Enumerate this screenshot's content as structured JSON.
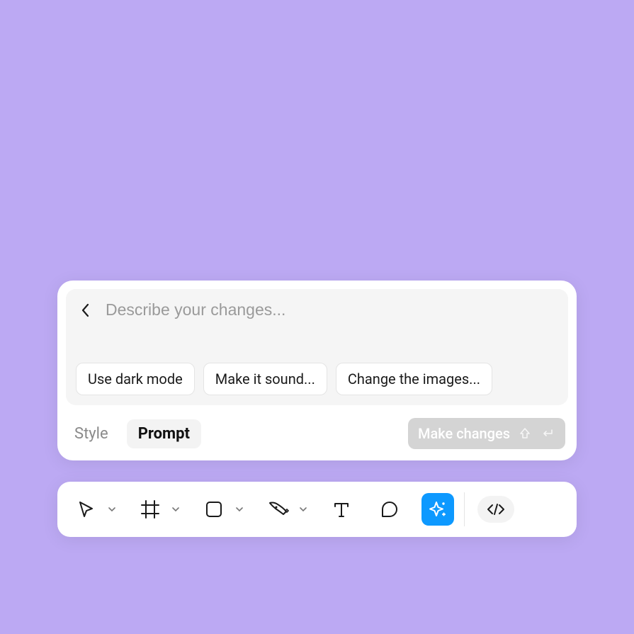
{
  "colors": {
    "background": "#bca9f3",
    "accent": "#0d99ff",
    "muted": "#d4d4d4"
  },
  "prompt_panel": {
    "placeholder": "Describe your changes...",
    "value": "",
    "suggestions": [
      {
        "label": "Use dark mode"
      },
      {
        "label": "Make it sound..."
      },
      {
        "label": "Change the images..."
      }
    ],
    "tabs": {
      "style": "Style",
      "prompt": "Prompt",
      "active": "prompt"
    },
    "submit": {
      "label": "Make changes",
      "shortcut": "Shift+Enter"
    },
    "icons": {
      "back": "chevron-left",
      "shift": "shift-key",
      "enter": "return-key"
    }
  },
  "toolbar": {
    "tools": [
      {
        "id": "select",
        "icon": "cursor-icon",
        "has_dropdown": true,
        "active": false
      },
      {
        "id": "frame",
        "icon": "frame-icon",
        "has_dropdown": true,
        "active": false
      },
      {
        "id": "rectangle",
        "icon": "rectangle-icon",
        "has_dropdown": true,
        "active": false
      },
      {
        "id": "pen",
        "icon": "pen-icon",
        "has_dropdown": true,
        "active": false
      },
      {
        "id": "text",
        "icon": "text-icon",
        "has_dropdown": false,
        "active": false
      },
      {
        "id": "comment",
        "icon": "comment-icon",
        "has_dropdown": false,
        "active": false
      },
      {
        "id": "ai",
        "icon": "sparkle-icon",
        "has_dropdown": false,
        "active": true
      }
    ],
    "dev_mode": {
      "icon": "code-icon"
    }
  }
}
